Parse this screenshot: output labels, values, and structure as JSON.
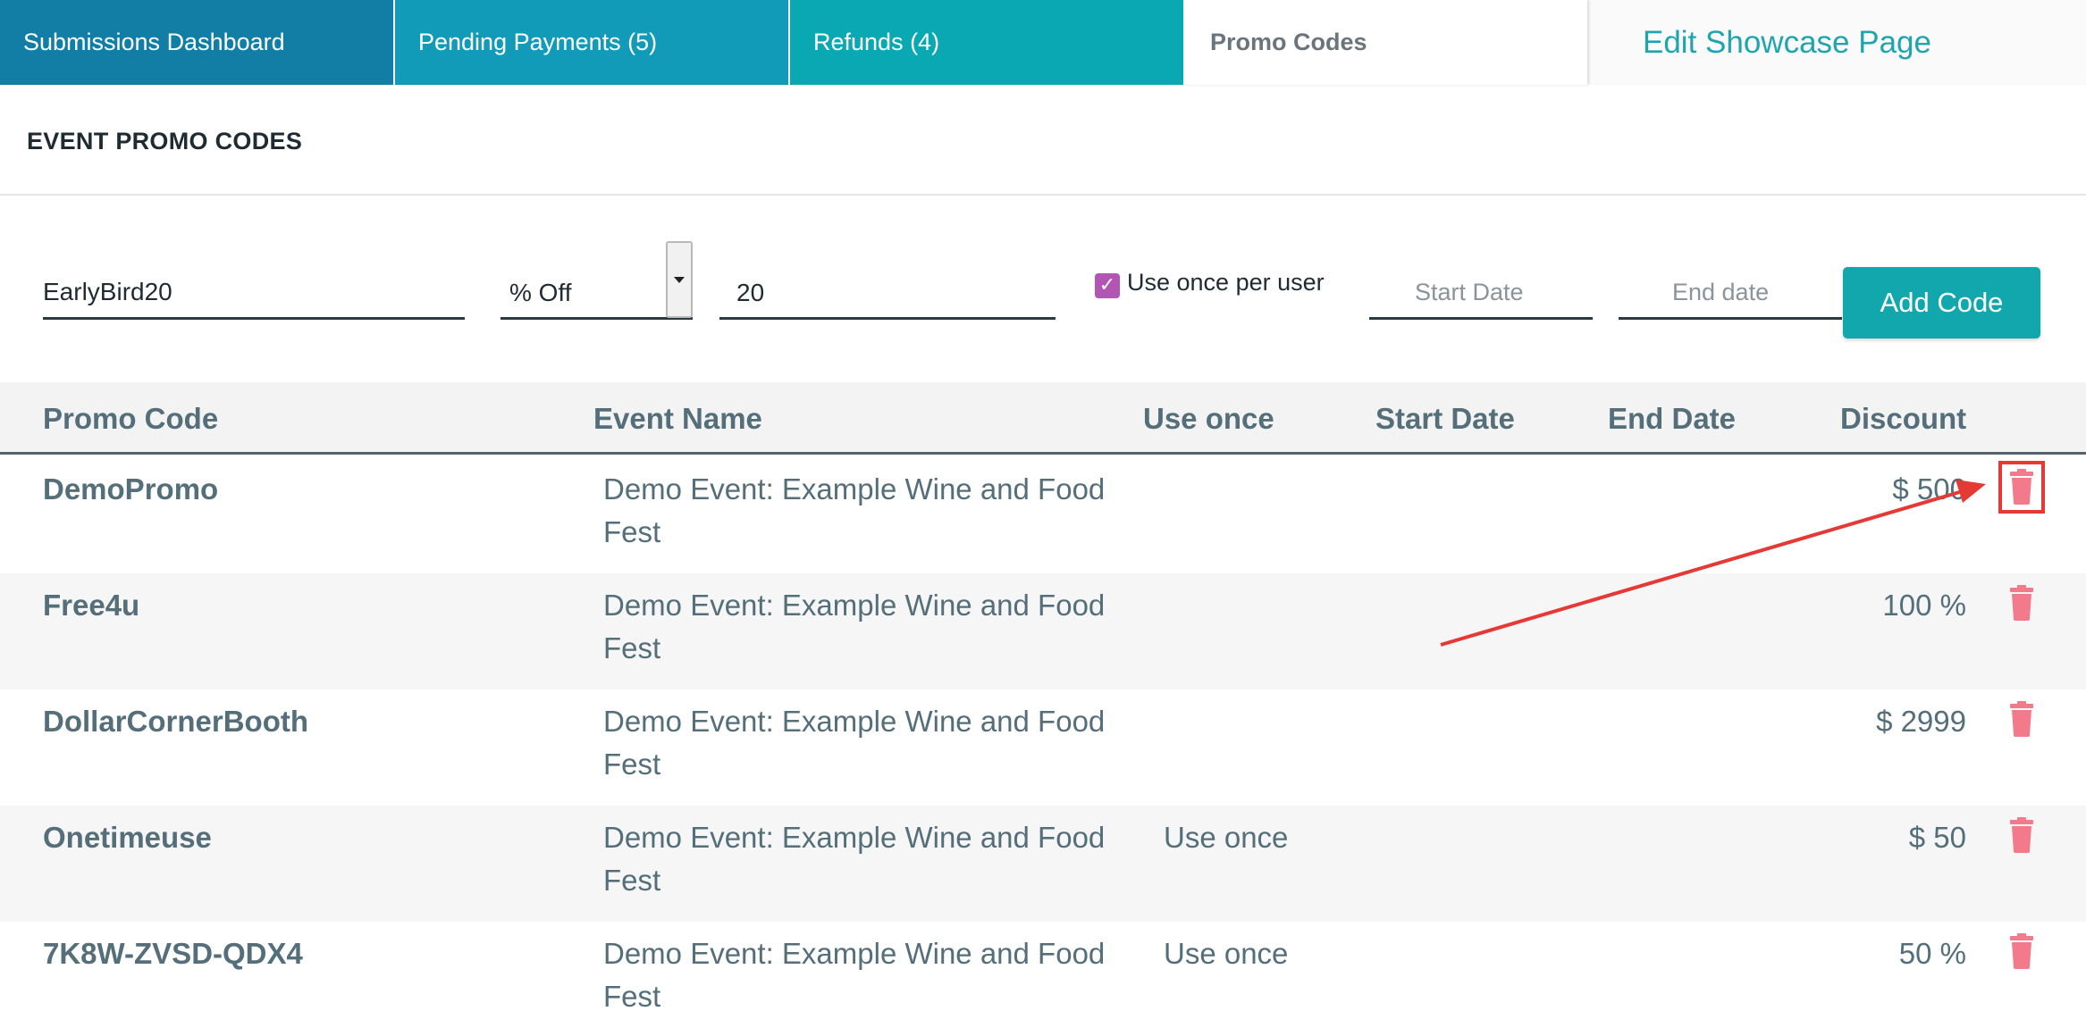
{
  "tabs": [
    {
      "label": "Submissions Dashboard"
    },
    {
      "label": "Pending Payments (5)"
    },
    {
      "label": "Refunds (4)"
    },
    {
      "label": "Promo Codes"
    },
    {
      "label": "Edit Showcase Page"
    }
  ],
  "section_title": "EVENT PROMO CODES",
  "form": {
    "code_value": "EarlyBird20",
    "type_value": "% Off",
    "amount_value": "20",
    "use_once_checked": true,
    "use_once_label": "Use once per user",
    "start_date_placeholder": "Start Date",
    "end_date_placeholder": "End date",
    "add_button": "Add Code"
  },
  "table": {
    "headers": {
      "code": "Promo Code",
      "event": "Event Name",
      "once": "Use once",
      "start": "Start Date",
      "end": "End Date",
      "discount": "Discount"
    },
    "rows": [
      {
        "code": "DemoPromo",
        "event": "Demo Event: Example Wine and Food Fest",
        "once": "",
        "start": "",
        "end": "",
        "discount": "$ 500"
      },
      {
        "code": "Free4u",
        "event": "Demo Event: Example Wine and Food Fest",
        "once": "",
        "start": "",
        "end": "",
        "discount": "100 %"
      },
      {
        "code": "DollarCornerBooth",
        "event": "Demo Event: Example Wine and Food Fest",
        "once": "",
        "start": "",
        "end": "",
        "discount": "$ 2999"
      },
      {
        "code": "Onetimeuse",
        "event": "Demo Event: Example Wine and Food Fest",
        "once": "Use once",
        "start": "",
        "end": "",
        "discount": "$ 50"
      },
      {
        "code": "7K8W-ZVSD-QDX4",
        "event": "Demo Event: Example Wine and Food Fest",
        "once": "Use once",
        "start": "",
        "end": "",
        "discount": "50 %"
      }
    ]
  },
  "icons": {
    "delete": "trash-icon",
    "checkbox": "check-icon",
    "select": "caret-down-icon"
  },
  "colors": {
    "tab1": "#127ea6",
    "tab2": "#129bb8",
    "tab3": "#0aa8b2",
    "accent": "#12a7ad",
    "trash": "#f27a8a",
    "annotation": "#e53935",
    "checkbox": "#b255b4"
  }
}
